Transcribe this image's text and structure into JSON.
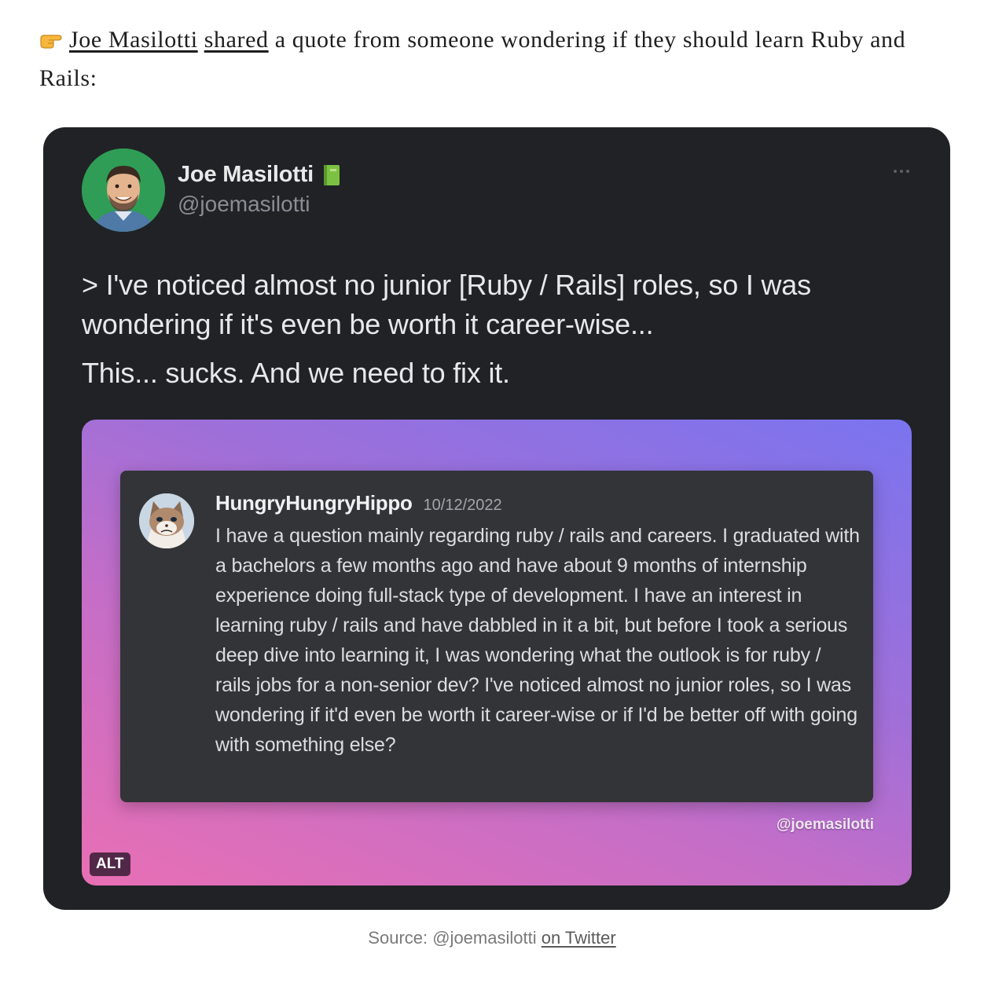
{
  "intro": {
    "link_author": "Joe Masilotti",
    "link_shared": "shared",
    "text_1": " a quote from someone wondering if they should learn Ruby and Rails:"
  },
  "tweet": {
    "author_name": "Joe Masilotti",
    "author_handle": "@joemasilotti",
    "paragraphs": [
      "> I've noticed almost no junior [Ruby / Rails] roles, so I was wondering if it's even be worth it career-wise...",
      "This... sucks. And we need to fix it."
    ],
    "media": {
      "username": "HungryHungryHippo",
      "date": "10/12/2022",
      "message": "I have a question mainly regarding ruby / rails and careers. I graduated with a bachelors a few months ago and have about 9 months of internship experience doing full-stack type of development. I have an interest in learning ruby / rails and have dabbled in it a bit, but before I took a serious deep dive into learning it, I was wondering what the outlook is for ruby / rails jobs for a non-senior dev? I've noticed almost no junior roles, so I was wondering if it'd even be worth it career-wise or if I'd be better off with going with something else?",
      "watermark": "@joemasilotti",
      "alt_label": "ALT"
    }
  },
  "caption": {
    "prefix": "Source: @joemasilotti ",
    "link": "on Twitter"
  }
}
